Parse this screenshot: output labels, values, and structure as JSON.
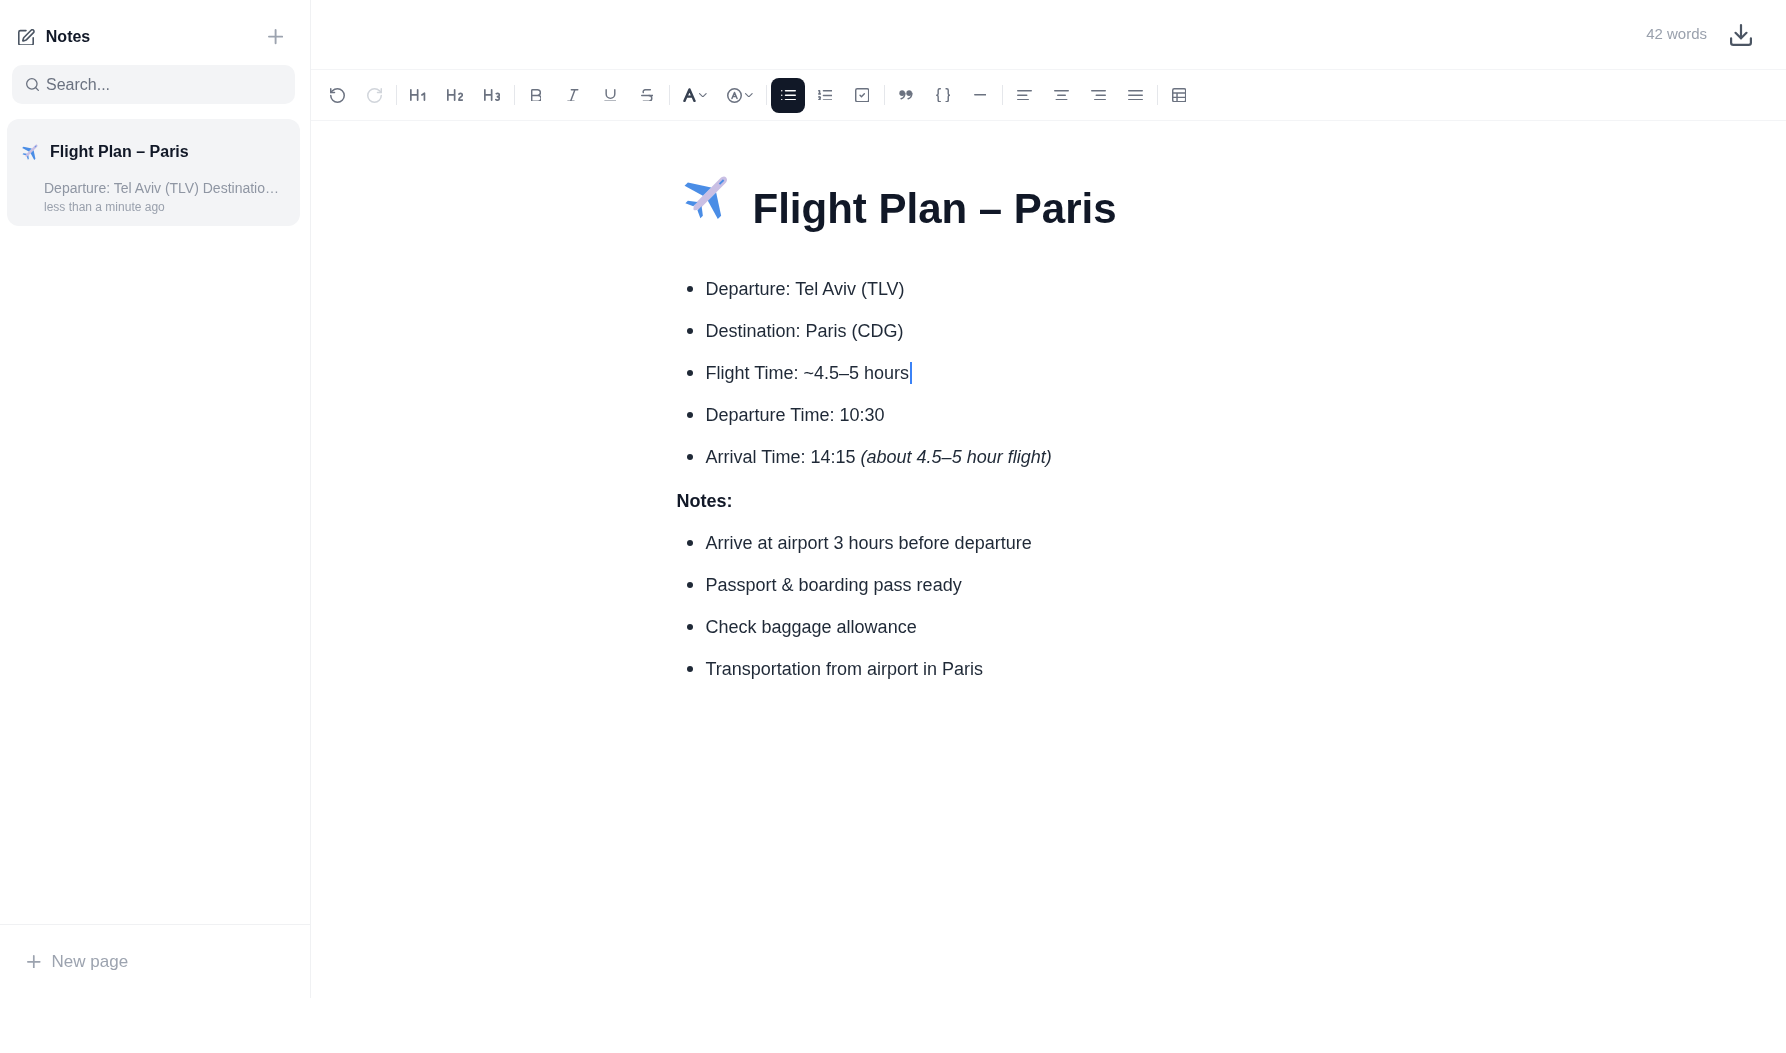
{
  "sidebar": {
    "title": "Notes",
    "search": {
      "placeholder": "Search..."
    },
    "pages": [
      {
        "title": "Flight Plan – Paris",
        "preview": "Departure: Tel Aviv (TLV) Destinatio…",
        "time": "less than a minute ago",
        "selected": true
      }
    ],
    "new_page": "New page"
  },
  "topbar": {
    "word_count": "42 words"
  },
  "toolbar": {
    "groups": [
      {
        "items": [
          {
            "kind": "undo",
            "active": false,
            "disabled": false
          },
          {
            "kind": "redo",
            "active": false,
            "disabled": true
          }
        ]
      },
      {
        "items": [
          {
            "kind": "heading1",
            "active": false,
            "disabled": false
          },
          {
            "kind": "heading2",
            "active": false,
            "disabled": false
          },
          {
            "kind": "heading3",
            "active": false,
            "disabled": false
          }
        ]
      },
      {
        "items": [
          {
            "kind": "bold",
            "active": false,
            "disabled": false
          },
          {
            "kind": "italic",
            "active": false,
            "disabled": false
          },
          {
            "kind": "underline",
            "active": false,
            "disabled": false
          },
          {
            "kind": "strike",
            "active": false,
            "disabled": false
          }
        ]
      },
      {
        "items": [
          {
            "kind": "textcolor",
            "active": false,
            "disabled": false
          },
          {
            "kind": "circled",
            "active": false,
            "disabled": false
          }
        ]
      },
      {
        "items": [
          {
            "kind": "bulletlist",
            "active": true,
            "disabled": false
          },
          {
            "kind": "orderedlist",
            "active": false,
            "disabled": false
          },
          {
            "kind": "tasklist",
            "active": false,
            "disabled": false
          }
        ]
      },
      {
        "items": [
          {
            "kind": "quote",
            "active": false,
            "disabled": false
          },
          {
            "kind": "code",
            "active": false,
            "disabled": false
          },
          {
            "kind": "rule",
            "active": false,
            "disabled": false
          }
        ]
      },
      {
        "items": [
          {
            "kind": "alignleft",
            "active": false,
            "disabled": false
          },
          {
            "kind": "aligncenter",
            "active": false,
            "disabled": false
          },
          {
            "kind": "alignright",
            "active": false,
            "disabled": false
          },
          {
            "kind": "justify",
            "active": false,
            "disabled": false
          }
        ]
      },
      {
        "items": [
          {
            "kind": "table",
            "active": false,
            "disabled": false
          }
        ]
      }
    ]
  },
  "document": {
    "title": "Flight Plan – Paris",
    "blocks": [
      {
        "kind": "bullets",
        "items": [
          {
            "text": "Departure: Tel Aviv (TLV)",
            "caret": false
          },
          {
            "text": "Destination: Paris (CDG)",
            "caret": false
          },
          {
            "text": "Flight Time: ~4.5–5 hours",
            "caret": true
          },
          {
            "text": "Departure Time: 10:30",
            "caret": false
          },
          {
            "text": "Arrival Time: 14:15 *(about 4.5–5 hour flight)*",
            "caret": false
          }
        ]
      },
      {
        "kind": "label",
        "text": "Notes:"
      },
      {
        "kind": "bullets",
        "items": [
          {
            "text": "Arrive at airport 3 hours before departure",
            "caret": false
          },
          {
            "text": "Passport & boarding pass ready",
            "caret": false
          },
          {
            "text": "Check baggage allowance",
            "caret": false
          },
          {
            "text": "Transportation from airport in Paris",
            "caret": false
          }
        ]
      }
    ]
  }
}
